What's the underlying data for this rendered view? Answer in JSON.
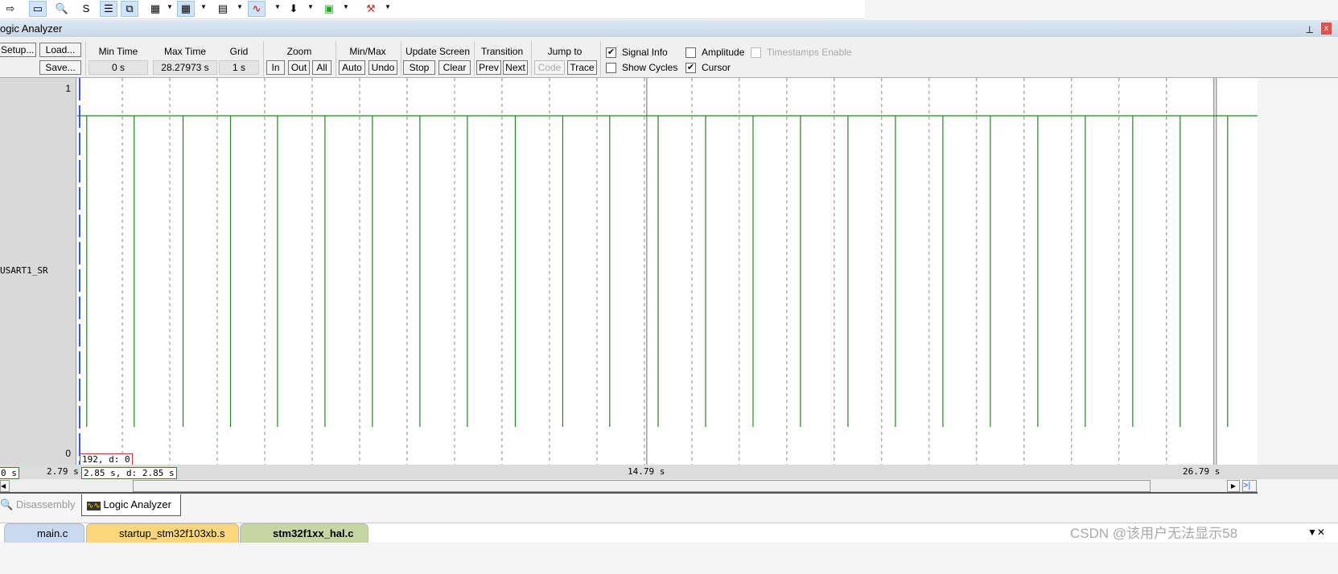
{
  "toolbar": {
    "icons": [
      "run-arrow-icon",
      "command-window-icon",
      "disassembly-icon",
      "symbols-icon",
      "registers-icon",
      "call-stack-icon",
      "watch-icon",
      "memory-icon",
      "serial-icon",
      "logic-analyzer-icon",
      "trace-icon",
      "system-viewer-icon",
      "tools-icon"
    ]
  },
  "window": {
    "title": "ogic Analyzer",
    "pin": "📌",
    "close": "x"
  },
  "controls": {
    "setup": "Setup...",
    "load": "Load...",
    "save": "Save...",
    "min_time_label": "Min Time",
    "min_time": "0 s",
    "max_time_label": "Max Time",
    "max_time": "28.27973 s",
    "grid_label": "Grid",
    "grid": "1 s",
    "zoom_label": "Zoom",
    "zoom_in": "In",
    "zoom_out": "Out",
    "zoom_all": "All",
    "minmax_label": "Min/Max",
    "auto": "Auto",
    "undo": "Undo",
    "update_label": "Update Screen",
    "stop": "Stop",
    "clear": "Clear",
    "transition_label": "Transition",
    "prev": "Prev",
    "next": "Next",
    "jump_label": "Jump to",
    "code": "Code",
    "trace": "Trace",
    "signal_info": "Signal Info",
    "amplitude": "Amplitude",
    "timestamps": "Timestamps Enable",
    "show_cycles": "Show Cycles",
    "cursor": "Cursor",
    "signal_info_checked": true,
    "amplitude_checked": false,
    "timestamps_checked": false,
    "show_cycles_checked": false,
    "cursor_checked": true
  },
  "signal": {
    "name": "USART1_SR",
    "y_max": "1",
    "y_min": "0",
    "value_box": "192,   d: 0"
  },
  "time": {
    "left_box": "0 s",
    "left_label": "2.79 s",
    "cursor_box": "2.85 s,   d: 2.85 s",
    "mid_label": "14.79 s",
    "right_label": "26.79 s"
  },
  "chart_data": {
    "type": "line",
    "signal": "USART1_SR",
    "x_unit": "s",
    "xlim": [
      2.79,
      27.66
    ],
    "grid_step_s": 1,
    "cursor_time_s": 2.85,
    "pulse_times_s": [
      2.99,
      3.99,
      5.02,
      6.02,
      7.01,
      8.01,
      9.01,
      10.01,
      11.01,
      12.02,
      13.02,
      14.01,
      15.03,
      16.03,
      17.03,
      18.03,
      19.03,
      20.03,
      21.03,
      22.03,
      23.03,
      24.03,
      25.03,
      26.03,
      27.03
    ],
    "high_level": "high",
    "low_level": "low",
    "line_color": "#1a8a1a",
    "cursor_color": "#3355ff"
  },
  "tabs": {
    "disassembly": "Disassembly",
    "logic_analyzer": "Logic Analyzer"
  },
  "files": [
    "main.c",
    "startup_stm32f103xb.s",
    "stm32f1xx_hal.c"
  ],
  "watermark": "CSDN @该用户无法显示58"
}
